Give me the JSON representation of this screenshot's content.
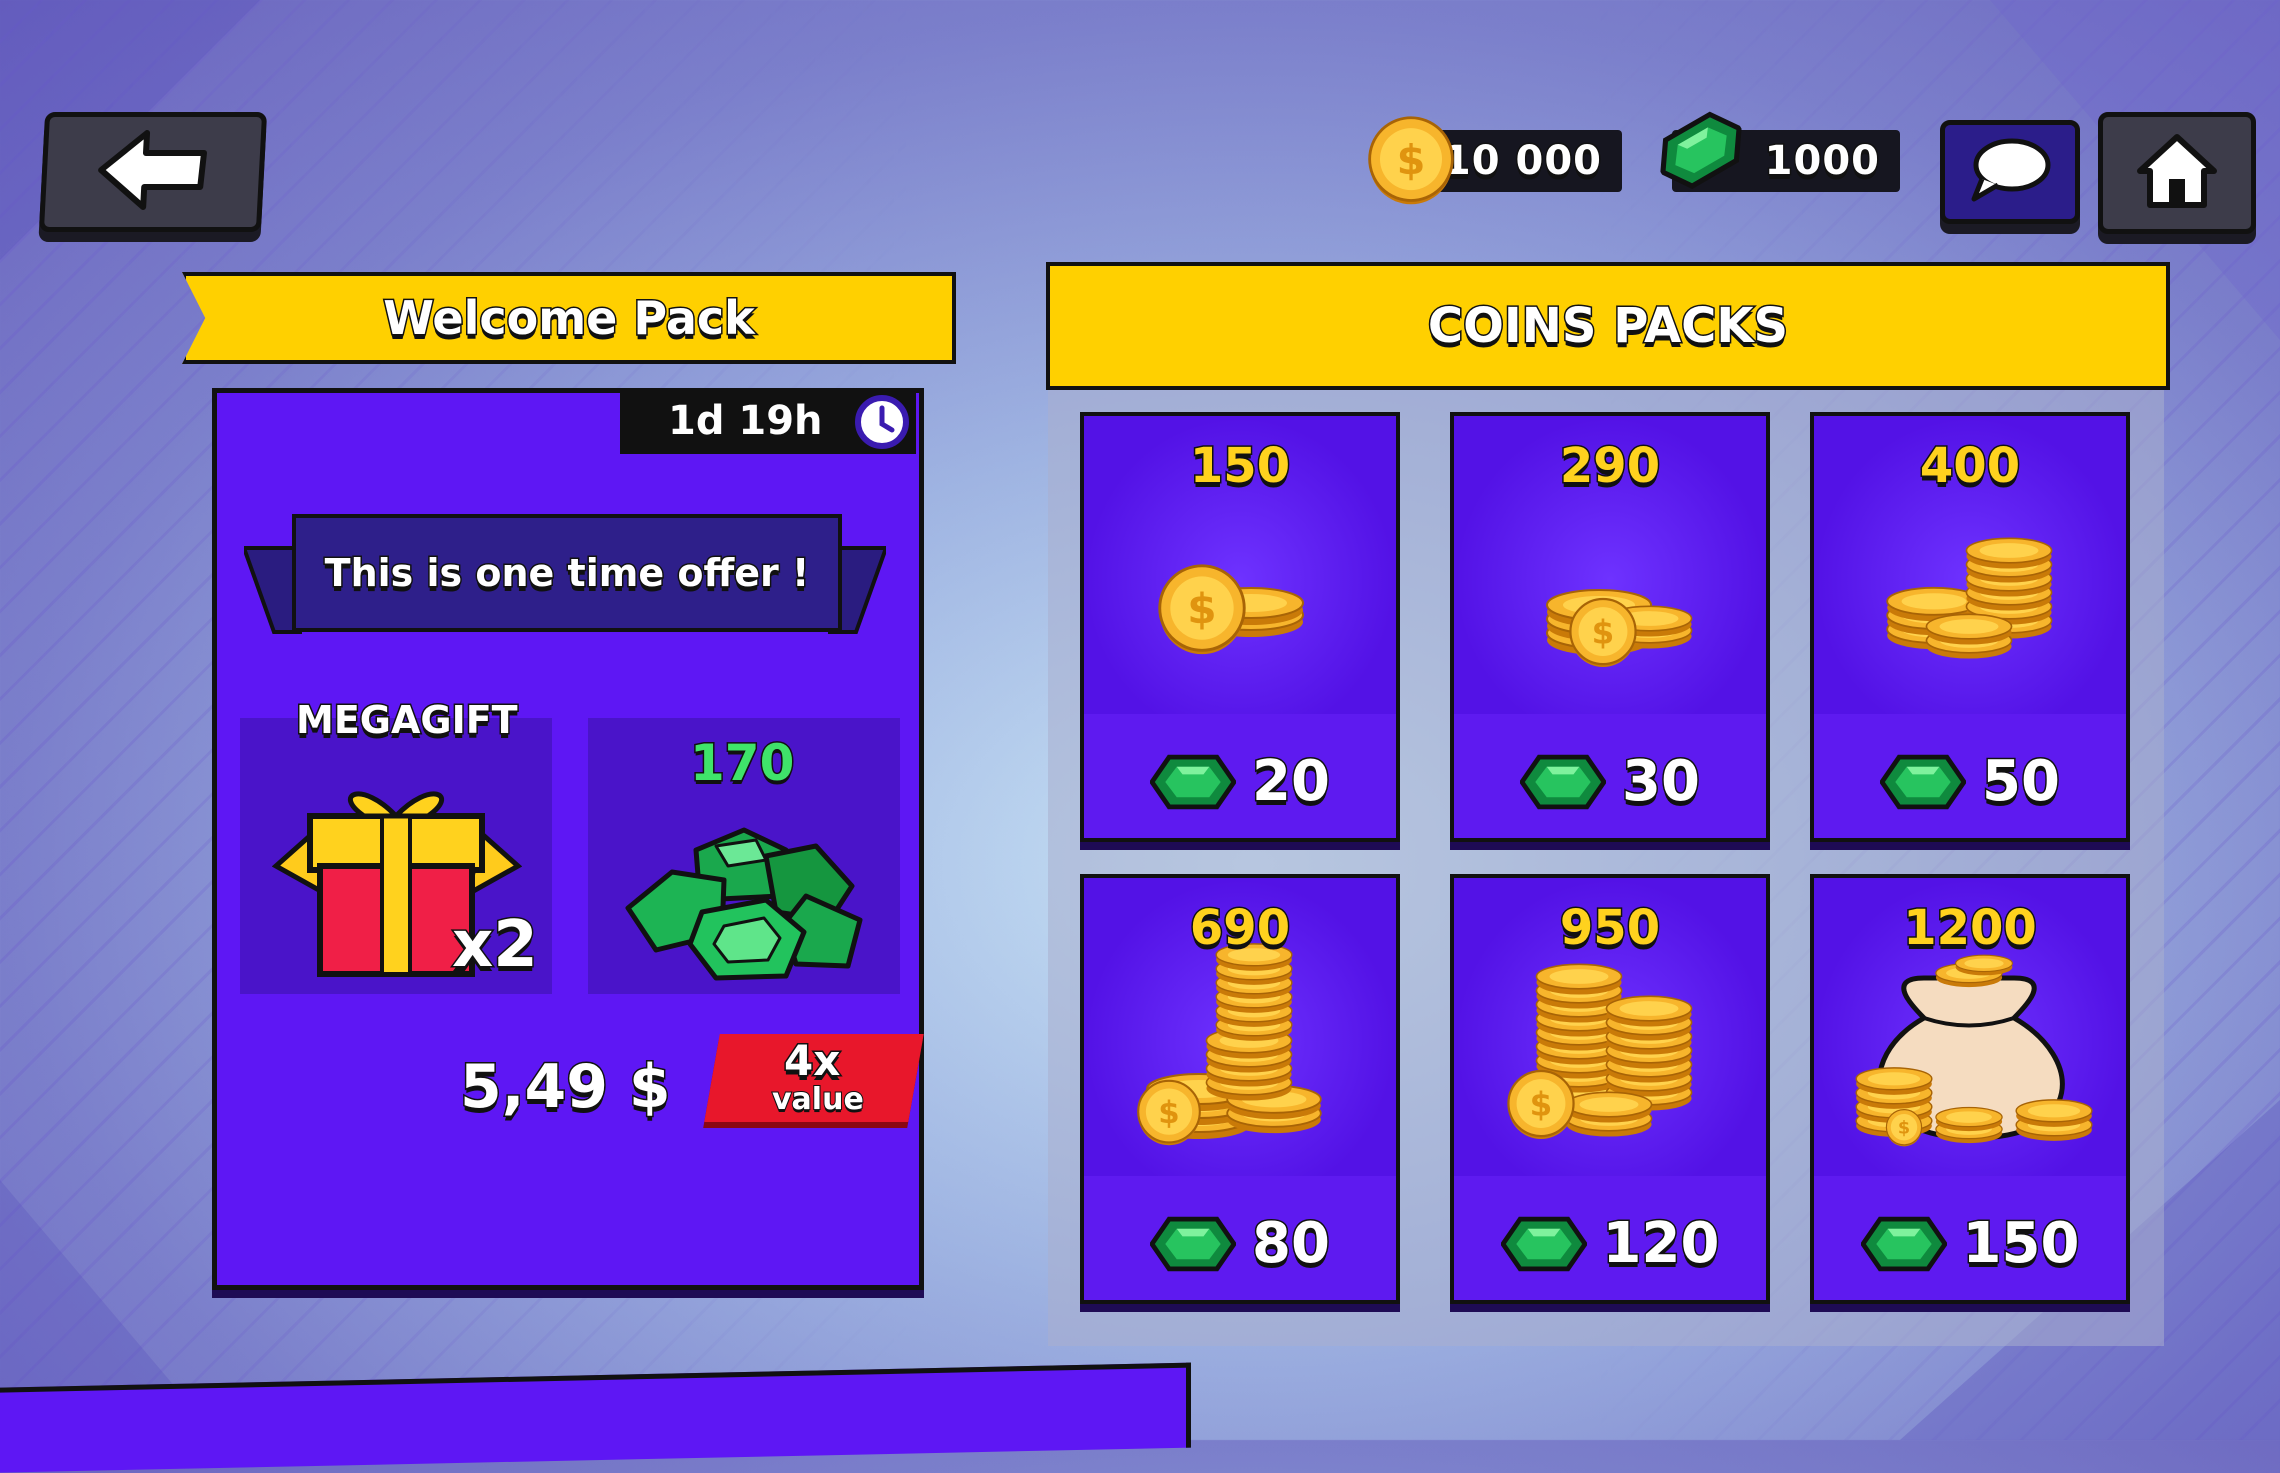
{
  "colors": {
    "panel_purple": "#5e17f4",
    "banner_yellow": "#ffd000",
    "gem_green": "#1dbf5a",
    "coin_gold": "#f7b52c",
    "tag_red": "#e8172b"
  },
  "top_bar": {
    "back_icon": "arrow-left-icon",
    "coins_amount": "10 000",
    "gems_amount": "1000",
    "chat_icon": "chat-bubble-icon",
    "home_icon": "home-icon"
  },
  "welcome": {
    "title": "Welcome Pack",
    "timer": "1d 19h",
    "offer_text": "This is one time offer !",
    "gift_label": "MEGAGIFT",
    "gift_multiplier": "x2",
    "gems_label": "170",
    "price": "5,49 $",
    "tag_top": "4x",
    "tag_bottom": "value"
  },
  "coins_packs": {
    "title": "COINS PACKS",
    "packs": [
      {
        "coins": "150",
        "gems": "20",
        "icon": "coins-small-icon"
      },
      {
        "coins": "290",
        "gems": "30",
        "icon": "coins-pile-icon"
      },
      {
        "coins": "400",
        "gems": "50",
        "icon": "coins-stacks-icon"
      },
      {
        "coins": "690",
        "gems": "80",
        "icon": "coins-tower-icon"
      },
      {
        "coins": "950",
        "gems": "120",
        "icon": "coins-towers-icon"
      },
      {
        "coins": "1200",
        "gems": "150",
        "icon": "coin-bag-icon"
      }
    ]
  }
}
